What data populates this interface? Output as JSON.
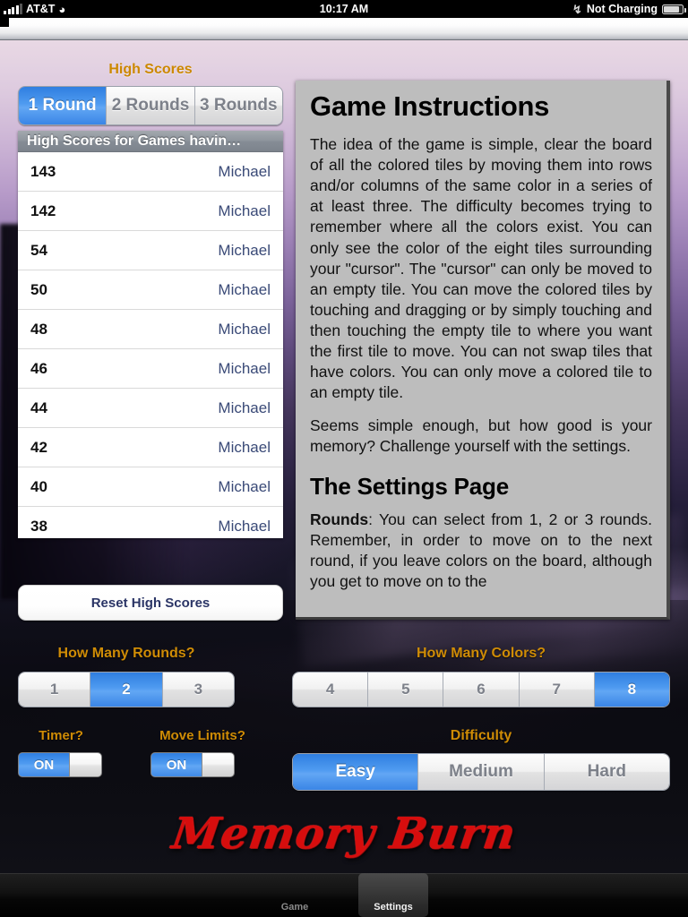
{
  "statusbar": {
    "carrier": "AT&T",
    "signal_icon": "signal-bars-icon",
    "wifi_icon": "wifi-icon",
    "time": "10:17 AM",
    "bluetooth_icon": "bluetooth-icon",
    "battery_label": "Not Charging",
    "battery_icon": "battery-icon"
  },
  "high_scores": {
    "title": "High Scores",
    "tabs": [
      {
        "label": "1 Round",
        "selected": true
      },
      {
        "label": "2 Rounds",
        "selected": false
      },
      {
        "label": "3 Rounds",
        "selected": false
      }
    ],
    "table_header": "High Scores for Games havin…",
    "rows": [
      {
        "score": "143",
        "name": "Michael"
      },
      {
        "score": "142",
        "name": "Michael"
      },
      {
        "score": "54",
        "name": "Michael"
      },
      {
        "score": "50",
        "name": "Michael"
      },
      {
        "score": "48",
        "name": "Michael"
      },
      {
        "score": "46",
        "name": "Michael"
      },
      {
        "score": "44",
        "name": "Michael"
      },
      {
        "score": "42",
        "name": "Michael"
      },
      {
        "score": "40",
        "name": "Michael"
      },
      {
        "score": "38",
        "name": "Michael"
      }
    ],
    "reset_button": "Reset High Scores"
  },
  "instructions": {
    "heading": "Game Instructions",
    "paragraph1": "The idea of the game is simple, clear the board of all the colored tiles by moving them into rows and/or columns of the same color in a series of at least three. The difficulty becomes trying to remember where all the colors exist. You can only see the color of the eight tiles surrounding your \"cursor\". The \"cursor\" can only be moved to an empty tile. You can move the colored tiles by touching and dragging or by simply touching and then touching the empty tile to where you want the first tile to move. You can not swap tiles that have colors. You can only move a colored tile to an empty tile.",
    "paragraph2": "Seems simple enough, but how good is your memory? Challenge yourself with the settings.",
    "heading2": "The Settings Page",
    "rounds_term": "Rounds",
    "rounds_text": ": You can select from 1, 2 or 3 rounds. Remember, in order to move on to the next round, if you leave colors on the board, although you get to move on to the"
  },
  "settings": {
    "rounds_label": "How Many Rounds?",
    "rounds_options": [
      {
        "label": "1",
        "selected": false
      },
      {
        "label": "2",
        "selected": true
      },
      {
        "label": "3",
        "selected": false
      }
    ],
    "colors_label": "How Many Colors?",
    "colors_options": [
      {
        "label": "4",
        "selected": false
      },
      {
        "label": "5",
        "selected": false
      },
      {
        "label": "6",
        "selected": false
      },
      {
        "label": "7",
        "selected": false
      },
      {
        "label": "8",
        "selected": true
      }
    ],
    "timer_label": "Timer?",
    "timer_value": "ON",
    "move_limits_label": "Move Limits?",
    "move_limits_value": "ON",
    "difficulty_label": "Difficulty",
    "difficulty_options": [
      {
        "label": "Easy",
        "selected": true
      },
      {
        "label": "Medium",
        "selected": false
      },
      {
        "label": "Hard",
        "selected": false
      }
    ]
  },
  "logo": {
    "text": "Memory Burn",
    "color": "#d60d0d"
  },
  "tabbar": {
    "tabs": [
      {
        "label": "Game",
        "selected": false
      },
      {
        "label": "Settings",
        "selected": true
      }
    ]
  },
  "colors": {
    "accent_orange": "#cf8c06",
    "selected_blue": "#4f9bf0",
    "panel_gray": "#bdbdbd",
    "link_blue": "#3a4a77"
  }
}
